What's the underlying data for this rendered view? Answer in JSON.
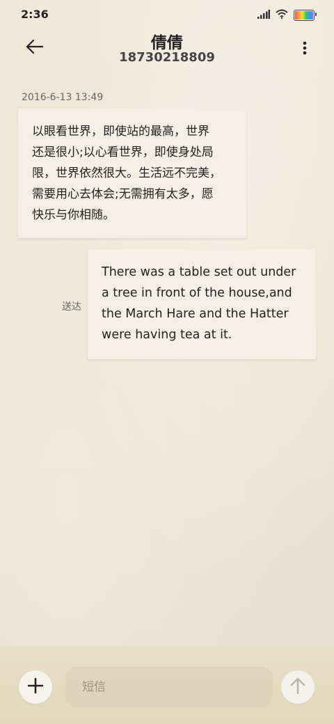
{
  "status_bar": {
    "time": "2:36",
    "icons": [
      "signal-icon",
      "wifi-icon",
      "battery-icon"
    ]
  },
  "header": {
    "contact_name": "倩倩",
    "contact_number": "18730218809",
    "back_icon": "arrow-left-icon",
    "menu_icon": "more-vertical-icon"
  },
  "conversation": {
    "timestamp": "2016-6-13 13:49",
    "incoming": {
      "lines": [
        "以眼看世界，即使站的最高，世界",
        "还是很小;以心看世界，即使身处局",
        "限，世界依然很大。生活远不完美，",
        "需要用心去体会;无需拥有太多，愿",
        "快乐与你相随。"
      ]
    },
    "outgoing": {
      "lines": [
        "There was a table set out under",
        "a tree in front of the house,and",
        "the March Hare and the Hatter",
        "were having tea at it."
      ],
      "status": "送达"
    }
  },
  "composer": {
    "placeholder": "短信",
    "value": "",
    "add_icon": "plus-icon",
    "send_icon": "arrow-up-icon"
  },
  "colors": {
    "background": "#ece6d6",
    "bubble": "#f3efe4",
    "bottom_bar": "#e6dcc3"
  }
}
